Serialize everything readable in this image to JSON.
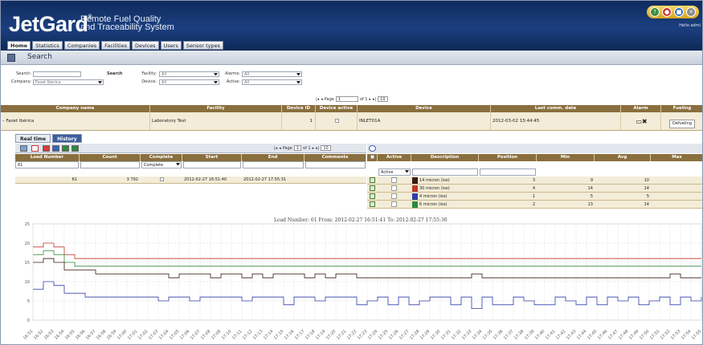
{
  "header": {
    "logo": "JetGard",
    "logo_tm": "®",
    "subtitle_line1": "Remote Fuel Quality",
    "subtitle_line2": "and Traceability System",
    "hello": "Hello admi"
  },
  "nav": [
    "Home",
    "Statistics",
    "Companies",
    "Facilities",
    "Devices",
    "Users",
    "Sensor types"
  ],
  "search_panel": {
    "title": "Search",
    "search_label": "Search:",
    "search_button": "Search",
    "company_label": "Company:",
    "company_value": "Fazet Ibérica",
    "facility_label": "Facility:",
    "facility_value": "All",
    "device_label": "Device:",
    "device_value": "All",
    "alarms_label": "Alarms:",
    "alarms_value": "All",
    "active_label": "Active:",
    "active_value": "All"
  },
  "company_pager": {
    "page_label": "Page",
    "page": "1",
    "of_label": "of 1",
    "page_size": "10"
  },
  "company_table": {
    "columns": [
      "Company name",
      "Facility",
      "Device ID",
      "Device active",
      "Device",
      "Last comm. date",
      "Alarm",
      "Fueling"
    ],
    "row": {
      "company": "Fazet Ibérica",
      "facility": "Laboratory Test",
      "device_id": "1",
      "device": "INLET01A",
      "last_comm": "2012-03-02 15:44:45",
      "fueling_button": "Defueling"
    }
  },
  "inner_tabs": [
    "Real time",
    "History"
  ],
  "load_pager": {
    "page_label": "Page",
    "page": "1",
    "of_label": "of 1",
    "page_size": "10"
  },
  "load_table": {
    "columns": [
      "Load Number",
      "Count",
      "Complete",
      "Start",
      "End",
      "Comments"
    ],
    "filter_load": "61",
    "filter_complete": "Complete",
    "row": {
      "load": "61",
      "count": "3 792",
      "start": "2012-02-27 16:51:40",
      "end": "2012-02-27 17:55:31"
    }
  },
  "sensor_table": {
    "columns": [
      "Active",
      "Description",
      "Position",
      "Min",
      "Avg",
      "Max"
    ],
    "filter_active": "Active",
    "rows": [
      {
        "desc": "14 micron (iso)",
        "position": "3",
        "min": "9",
        "avg": "10",
        "color": "#3a1a10"
      },
      {
        "desc": "30 micron (iso)",
        "position": "4",
        "min": "14",
        "avg": "14",
        "color": "#c0392b"
      },
      {
        "desc": "4 micron (iso)",
        "position": "1",
        "min": "5",
        "avg": "5",
        "color": "#2f3fa8"
      },
      {
        "desc": "6 micron (iso)",
        "position": "2",
        "min": "13",
        "avg": "14",
        "color": "#2e8b3a"
      }
    ]
  },
  "chart_data": {
    "type": "line",
    "title": "Load Number: 61 From: 2012-02-27 16:51:41 To: 2012-02-27 17:55:30",
    "ylim": [
      0,
      25
    ],
    "yticks": [
      "0",
      "5",
      "10",
      "15",
      "20",
      "25"
    ],
    "x": [
      "16:51",
      "16:52",
      "16:53",
      "16:54",
      "16:55",
      "16:56",
      "16:57",
      "16:58",
      "16:59",
      "17:00",
      "17:01",
      "17:02",
      "17:03",
      "17:04",
      "17:05",
      "17:06",
      "17:07",
      "17:08",
      "17:09",
      "17:10",
      "17:11",
      "17:12",
      "17:13",
      "17:14",
      "17:15",
      "17:16",
      "17:17",
      "17:18",
      "17:19",
      "17:20",
      "17:21",
      "17:22",
      "17:23",
      "17:24",
      "17:25",
      "17:26",
      "17:27",
      "17:28",
      "17:29",
      "17:30",
      "17:31",
      "17:32",
      "17:33",
      "17:34",
      "17:35",
      "17:36",
      "17:37",
      "17:38",
      "17:39",
      "17:40",
      "17:41",
      "17:42",
      "17:43",
      "17:44",
      "17:45",
      "17:46",
      "17:47",
      "17:48",
      "17:49",
      "17:50",
      "17:51",
      "17:52",
      "17:53",
      "17:54",
      "17:55"
    ],
    "series": [
      {
        "name": "30 micron (iso)",
        "color": "#c0392b",
        "values": [
          19,
          20,
          19,
          17,
          16,
          16,
          16,
          16,
          16,
          16,
          16,
          16,
          16,
          16,
          16,
          16,
          16,
          16,
          16,
          16,
          16,
          16,
          16,
          16,
          16,
          16,
          16,
          16,
          16,
          16,
          16,
          16,
          16,
          16,
          16,
          16,
          16,
          16,
          16,
          16,
          16,
          16,
          16,
          16,
          16,
          16,
          16,
          16,
          16,
          16,
          16,
          16,
          16,
          16,
          16,
          16,
          16,
          16,
          16,
          16,
          16,
          16,
          16,
          16,
          16
        ]
      },
      {
        "name": "6 micron (iso)",
        "color": "#2e8b3a",
        "values": [
          17,
          18,
          17,
          15,
          14,
          14,
          14,
          14,
          14,
          14,
          14,
          14,
          14,
          14,
          14,
          14,
          14,
          14,
          14,
          14,
          14,
          14,
          14,
          14,
          14,
          14,
          14,
          14,
          14,
          14,
          14,
          14,
          14,
          14,
          14,
          14,
          14,
          14,
          14,
          14,
          14,
          14,
          14,
          14,
          14,
          14,
          14,
          14,
          14,
          14,
          14,
          14,
          14,
          14,
          14,
          14,
          14,
          14,
          14,
          14,
          14,
          14,
          14,
          14,
          14
        ]
      },
      {
        "name": "14 micron (iso)",
        "color": "#3a1a10",
        "values": [
          15,
          16,
          15,
          13,
          13,
          13,
          12,
          12,
          12,
          12,
          12,
          12,
          12,
          11,
          12,
          12,
          12,
          11,
          12,
          12,
          11,
          12,
          11,
          12,
          12,
          12,
          11,
          12,
          11,
          12,
          12,
          11,
          11,
          11,
          11,
          11,
          11,
          11,
          11,
          11,
          11,
          11,
          12,
          11,
          11,
          11,
          11,
          11,
          11,
          11,
          11,
          11,
          11,
          11,
          11,
          11,
          11,
          11,
          11,
          11,
          11,
          12,
          11,
          11,
          11
        ]
      },
      {
        "name": "4 micron (iso)",
        "color": "#2f3fa8",
        "values": [
          8,
          10,
          9,
          7,
          7,
          6,
          6,
          6,
          6,
          6,
          6,
          6,
          5,
          6,
          6,
          5,
          6,
          6,
          6,
          6,
          5,
          6,
          6,
          6,
          4,
          6,
          6,
          5,
          6,
          6,
          6,
          4,
          5,
          6,
          4,
          6,
          4,
          5,
          6,
          6,
          4,
          6,
          3,
          6,
          4,
          4,
          6,
          5,
          4,
          4,
          6,
          5,
          4,
          6,
          4,
          6,
          5,
          6,
          4,
          5,
          6,
          4,
          6,
          5,
          6
        ]
      }
    ]
  }
}
